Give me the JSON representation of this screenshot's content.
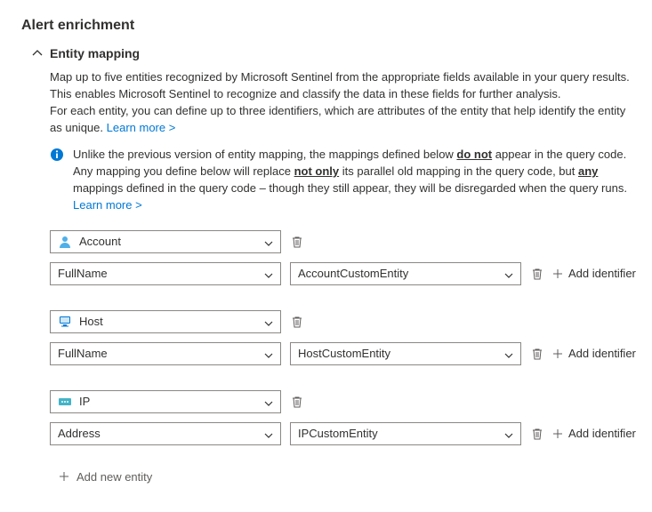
{
  "page_title": "Alert enrichment",
  "section": {
    "label": "Entity mapping",
    "description_l1": "Map up to five entities recognized by Microsoft Sentinel from the appropriate fields available in your query results.",
    "description_l2": "This enables Microsoft Sentinel to recognize and classify the data in these fields for further analysis.",
    "description_l3": "For each entity, you can define up to three identifiers, which are attributes of the entity that help identify the entity as unique.",
    "learn_more": "Learn more >",
    "info_p1": "Unlike the previous version of entity mapping, the mappings defined below ",
    "info_u1": "do not",
    "info_p2": " appear in the query code. Any mapping you define below will replace ",
    "info_u2": "not only",
    "info_p3": " its parallel old mapping in the query code, but ",
    "info_u3": "any",
    "info_p4": " mappings defined in the query code – though they still appear, they will be disregarded when the query runs. ",
    "info_learn": "Learn more >"
  },
  "entities": [
    {
      "type": "Account",
      "identifier": "FullName",
      "value": "AccountCustomEntity"
    },
    {
      "type": "Host",
      "identifier": "FullName",
      "value": "HostCustomEntity"
    },
    {
      "type": "IP",
      "identifier": "Address",
      "value": "IPCustomEntity"
    }
  ],
  "labels": {
    "add_identifier": "Add identifier",
    "add_entity": "Add new entity"
  }
}
